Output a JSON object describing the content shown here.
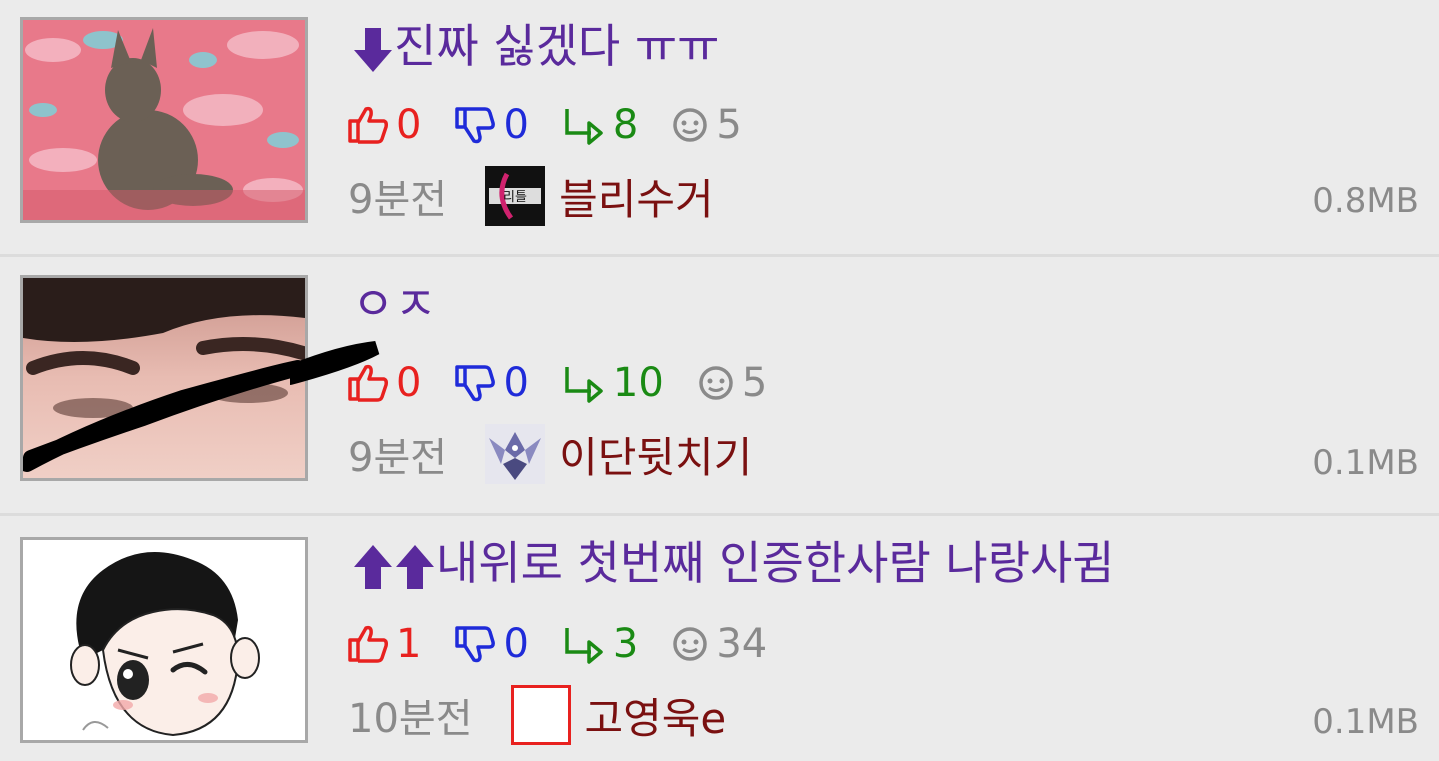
{
  "posts": [
    {
      "title": "진짜 싫겠다 ㅠㅠ",
      "title_arrows": [
        "down"
      ],
      "thumbnail": "cat-photo",
      "likes": "0",
      "dislikes": "0",
      "shares": "8",
      "comments": "5",
      "time": "9분전",
      "author_avatar": "logo-avatar",
      "author": "블리수거",
      "size": "0.8MB"
    },
    {
      "title": "ㅇㅈ",
      "title_arrows": [],
      "thumbnail": "face-photo-scribbled",
      "likes": "0",
      "dislikes": "0",
      "shares": "10",
      "comments": "5",
      "time": "9분전",
      "author_avatar": "robot-avatar",
      "author": "이단뒷치기",
      "size": "0.1MB"
    },
    {
      "title": "내위로 첫번째 인증한사람 나랑사귐",
      "title_arrows": [
        "up",
        "up"
      ],
      "thumbnail": "cartoon-boy-drawing",
      "likes": "1",
      "dislikes": "0",
      "shares": "3",
      "comments": "34",
      "time": "10분전",
      "author_avatar": "empty-avatar",
      "author": "고영욱e",
      "size": "0.1MB"
    }
  ],
  "colors": {
    "title": "#5a2a9c",
    "like": "#e8211f",
    "dislike": "#1f2bd9",
    "share": "#1a8a14",
    "muted": "#8a8a8a",
    "author": "#7a1010",
    "background": "#ebebeb"
  },
  "icons": {
    "like": "thumbs-up-icon",
    "dislike": "thumbs-down-icon",
    "share": "share-arrow-icon",
    "comment": "smiley-comment-icon",
    "arrow_down": "arrow-down-icon",
    "arrow_up": "arrow-up-icon"
  }
}
